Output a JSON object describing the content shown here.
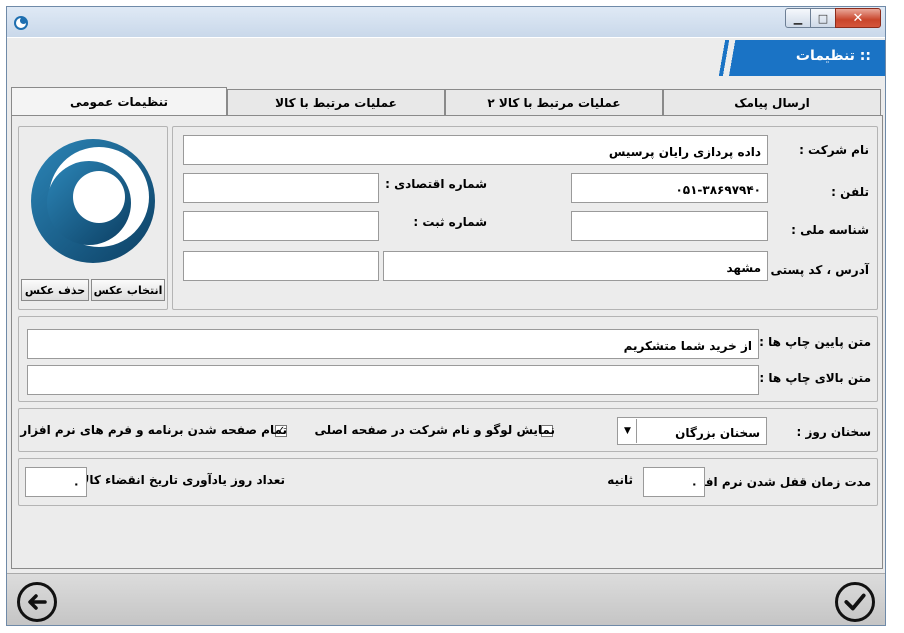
{
  "window": {
    "close_glyph": "✕",
    "min_glyph": "▁",
    "max_glyph": "□"
  },
  "header": {
    "title": ":: تنظیمات"
  },
  "tabs": [
    {
      "label": "ارسال پیامک"
    },
    {
      "label": "عملیات مرتبط با کالا ۲"
    },
    {
      "label": "عملیات مرتبط با کالا"
    },
    {
      "label": "تنظیمات عمومی"
    }
  ],
  "company": {
    "name_label": "نام شرکت :",
    "name_value": "داده پردازی رایان پرسیس",
    "phone_label": "تلفن :",
    "phone_value": "۰۵۱-۳۸۶۹۷۹۴۰",
    "economic_label": "شماره اقتصادی :",
    "economic_value": "",
    "national_label": "شناسه ملی :",
    "national_value": "",
    "reg_label": "شماره ثبت :",
    "reg_value": "",
    "address_label": "آدرس ، کد پستی :",
    "address_value": "مشهد",
    "postal_value": ""
  },
  "logo": {
    "select_label": "انتخاب عکس",
    "delete_label": "حذف عکس"
  },
  "print": {
    "footer_label": "متن پایین چاپ ها :",
    "footer_value": "از خرید شما متشکریم",
    "header_label": "متن بالای چاپ ها :",
    "header_value": ""
  },
  "options": {
    "quote_label": "سخنان روز :",
    "quote_value": "سخنان بزرگان",
    "show_logo_label": "نمایش لوگو و نام شرکت در صفحه اصلی",
    "show_logo_checked": false,
    "fullscreen_label": "تمام صفحه شدن برنامه و فرم های نرم افزار",
    "fullscreen_checked": true
  },
  "timing": {
    "lock_label": "مدت زمان قفل شدن نرم افزار :",
    "lock_value": "۰",
    "lock_unit": "ثانیه",
    "expire_label": "تعداد روز یادآوری تاریخ انقضاء کالا :",
    "expire_value": "۰"
  },
  "colors": {
    "accent": "#1a73c5",
    "logo_dark": "#0f4f7a"
  }
}
